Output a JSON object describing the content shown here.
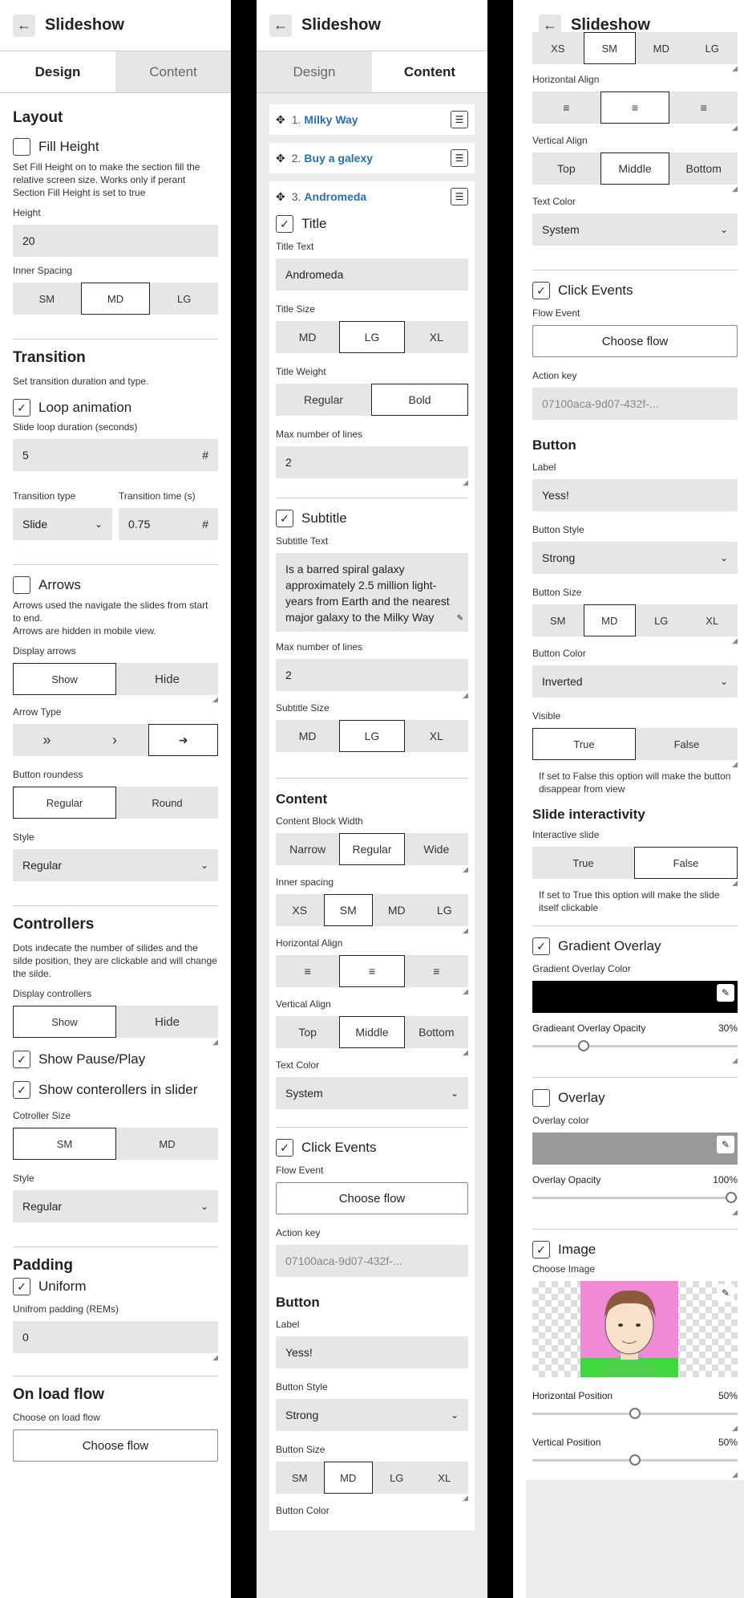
{
  "header": {
    "title": "Slideshow",
    "back_icon": "arrow-left-icon"
  },
  "tabs": [
    "Design",
    "Content"
  ],
  "design": {
    "layout_title": "Layout",
    "fill_height_label": "Fill Height",
    "fill_height_help": "Set Fill Height on to make the section fill the relative screen size. Works only if perant Section Fill Height is set to true",
    "height_label": "Height",
    "height_value": "20",
    "inner_spacing_label": "Inner Spacing",
    "inner_spacing_opts": [
      "SM",
      "MD",
      "LG"
    ],
    "transition_title": "Transition",
    "transition_help": "Set transition duration and type.",
    "loop_label": "Loop animation",
    "slide_loop_label": "Slide loop duration (seconds)",
    "slide_loop_value": "5",
    "hash": "#",
    "transition_type_label": "Transition type",
    "transition_type_value": "Slide",
    "transition_time_label": "Transition time (s)",
    "transition_time_value": "0.75",
    "arrows_label": "Arrows",
    "arrows_help1": "Arrows used the navigate the slides from start to end.",
    "arrows_help2": "Arrows are hidden in mobile view.",
    "display_arrows_label": "Display arrows",
    "show": "Show",
    "hide": "Hide",
    "arrow_type_label": "Arrow Type",
    "arrow_types": [
      "»",
      "›",
      "➜"
    ],
    "button_roundess_label": "Button roundess",
    "roundess_opts": [
      "Regular",
      "Round"
    ],
    "style_label": "Style",
    "style_value": "Regular",
    "controllers_title": "Controllers",
    "controllers_help": "Dots indecate the number of silides and the silde position, they are clickable and will change the silde.",
    "display_controllers_label": "Display controllers",
    "show_pause_label": "Show Pause/Play",
    "show_controllers_label": "Show conterollers in slider",
    "controller_size_label": "Cotroller Size",
    "controller_size_opts": [
      "SM",
      "MD"
    ],
    "padding_title": "Padding",
    "uniform_label": "Uniform",
    "uniform_padding_label": "Unifrom padding (REMs)",
    "uniform_padding_value": "0",
    "onload_title": "On load flow",
    "onload_label": "Choose on load flow",
    "choose_flow": "Choose flow"
  },
  "content": {
    "items": [
      {
        "num": "1.",
        "name": "Milky Way"
      },
      {
        "num": "2.",
        "name": "Buy a galexy"
      },
      {
        "num": "3.",
        "name": "Andromeda"
      }
    ],
    "title_label": "Title",
    "title_text_label": "Title Text",
    "title_text_value": "Andromeda",
    "title_size_label": "Title Size",
    "size_opts_mlx": [
      "MD",
      "LG",
      "XL"
    ],
    "title_weight_label": "Title Weight",
    "weight_opts": [
      "Regular",
      "Bold"
    ],
    "max_lines_label": "Max number of lines",
    "max_lines_value": "2",
    "subtitle_label": "Subtitle",
    "subtitle_text_label": "Subtitle Text",
    "subtitle_text_value": "Is a barred spiral galaxy approximately 2.5 million light-years from Earth and the nearest major galaxy to the Milky Way",
    "subtitle_size_label": "Subtitle Size",
    "content_title": "Content",
    "content_width_label": "Content Block Width",
    "width_opts": [
      "Narrow",
      "Regular",
      "Wide"
    ],
    "inner_spacing_label": "Inner spacing",
    "spacing_opts": [
      "XS",
      "SM",
      "MD",
      "LG"
    ],
    "h_align_label": "Horizontal Align",
    "v_align_label": "Vertical Align",
    "v_align_opts": [
      "Top",
      "Middle",
      "Bottom"
    ],
    "text_color_label": "Text Color",
    "text_color_value": "System",
    "click_events_label": "Click Events",
    "flow_event_label": "Flow Event",
    "choose_flow": "Choose flow",
    "action_key_label": "Action key",
    "action_key_value": "07100aca-9d07-432f-...",
    "button_title": "Button",
    "label_label": "Label",
    "label_value": "Yess!",
    "button_style_label": "Button Style",
    "button_style_value": "Strong",
    "button_size_label": "Button Size",
    "button_size_opts": [
      "SM",
      "MD",
      "LG",
      "XL"
    ],
    "button_color_label": "Button Color",
    "button_color_value": "Inverted",
    "visible_label": "Visible",
    "tf_opts": [
      "True",
      "False"
    ],
    "visible_help": "If set to False this option will make the button disappear from view",
    "interactivity_title": "Slide interactivity",
    "interactive_label": "Interactive slide",
    "interactive_help": "If set to True this option will make the slide itself clickable",
    "gradient_label": "Gradient Overlay",
    "gradient_color_label": "Gradient Overlay Color",
    "gradient_opacity_label": "Gradieant Overlay Opacity",
    "gradient_opacity_value": "30%",
    "overlay_label": "Overlay",
    "overlay_color_label": "Overlay color",
    "overlay_opacity_label": "Overlay Opacity",
    "overlay_opacity_value": "100%",
    "image_label": "Image",
    "choose_image_label": "Choose Image",
    "h_pos_label": "Horizontal Position",
    "h_pos_value": "50%",
    "v_pos_label": "Vertical Position",
    "v_pos_value": "50%"
  },
  "colors": {
    "link": "#2a6fb0",
    "gradient": "#000000",
    "overlay": "#999999",
    "image_bg": "#f08ad6"
  }
}
